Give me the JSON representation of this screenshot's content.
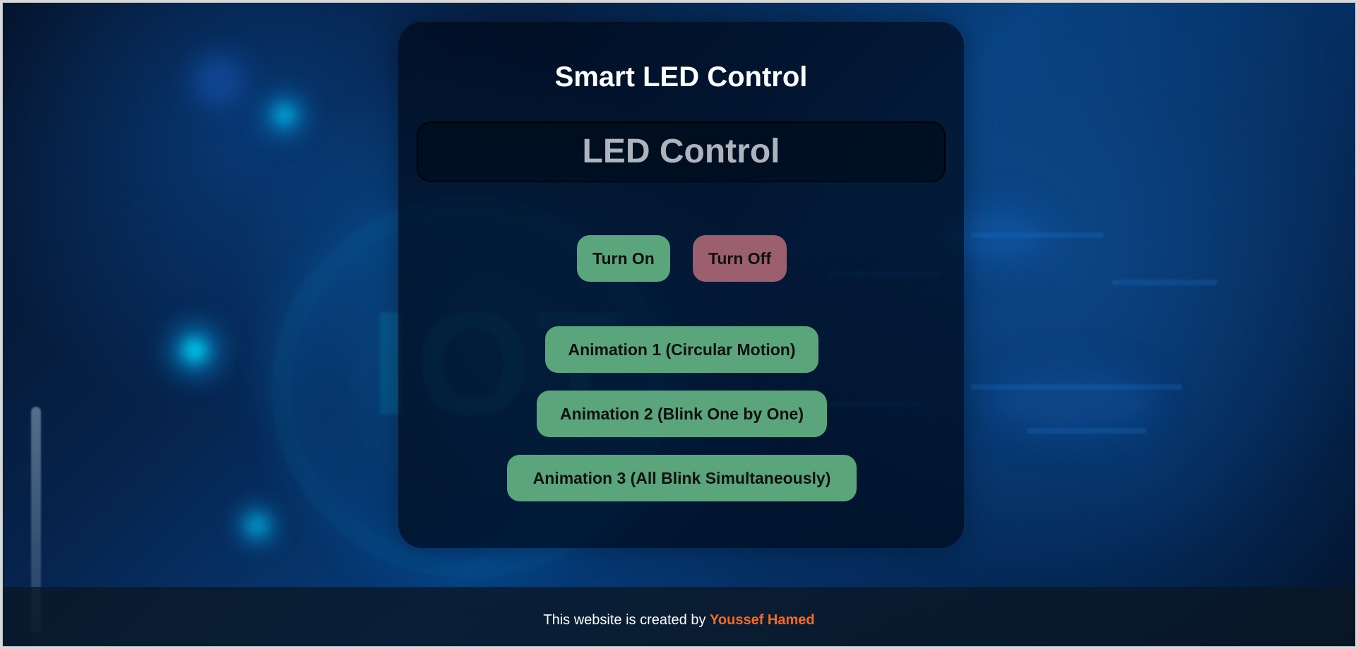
{
  "page": {
    "title": "Smart LED Control",
    "display_text": "LED Control"
  },
  "controls": {
    "turn_on_label": "Turn On",
    "turn_off_label": "Turn Off",
    "animation_1_label": "Animation 1 (Circular Motion)",
    "animation_2_label": "Animation 2 (Blink One by One)",
    "animation_3_label": "Animation 3 (All Blink Simultaneously)"
  },
  "footer": {
    "prefix": "This website is created by ",
    "author": "Youssef Hamed"
  },
  "colors": {
    "background_primary": "#063d7b",
    "card_overlay": "#000918",
    "button_green": "#5aa57b",
    "button_red": "#9b5f6d",
    "footer_accent": "#ff6a1a"
  },
  "icons": {
    "background_art": "iot-network-background"
  }
}
